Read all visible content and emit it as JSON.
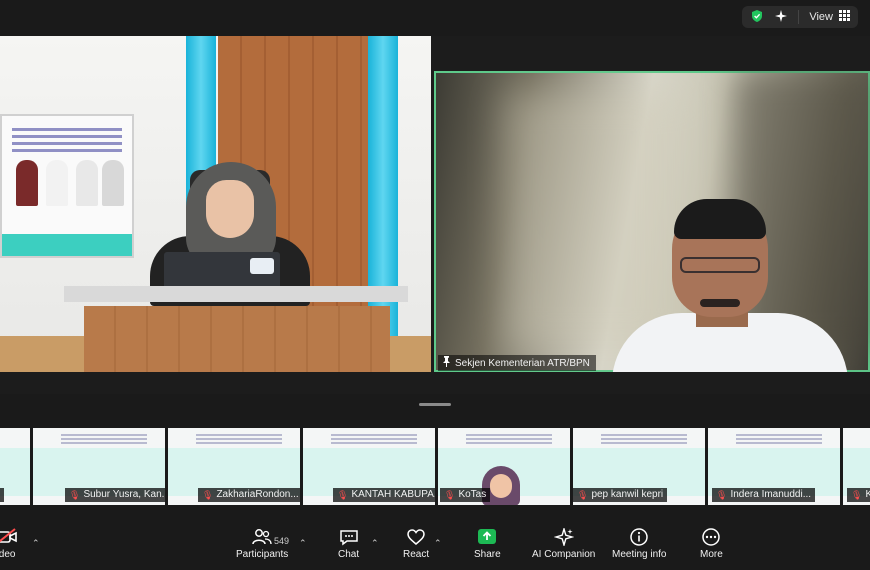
{
  "top_bar": {
    "view_label": "View"
  },
  "main_video": {
    "right_speaker_name": "Sekjen Kementerian ATR/BPN"
  },
  "filmstrip": {
    "participants": [
      {
        "name": ""
      },
      {
        "name": "Subur Yusra, Kan..."
      },
      {
        "name": "ZakhariaRondon..."
      },
      {
        "name": "KANTAH KABUPA..."
      },
      {
        "name": "KoTas"
      },
      {
        "name": "pep kanwil kepri"
      },
      {
        "name": "Indera Imanuddi..."
      },
      {
        "name": "Ka"
      }
    ]
  },
  "toolbar": {
    "video_label": "ideo",
    "participants_label": "Participants",
    "participants_count": "549",
    "chat_label": "Chat",
    "react_label": "React",
    "share_label": "Share",
    "ai_companion_label": "AI Companion",
    "meeting_info_label": "Meeting info",
    "more_label": "More"
  },
  "colors": {
    "background": "#1a1a1a",
    "active_speaker_border": "#5ec98a",
    "share_green": "#1db954",
    "muted_red": "#ff4d4d",
    "shield_green": "#22c55e"
  }
}
